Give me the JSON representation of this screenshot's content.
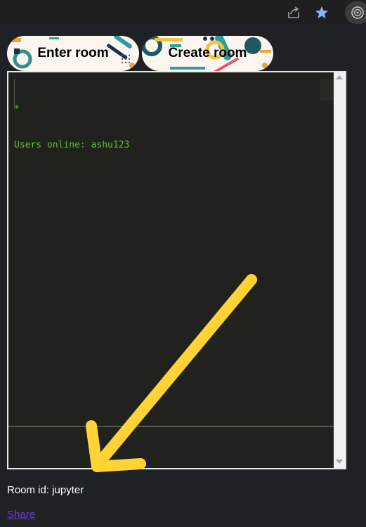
{
  "toolbar": {
    "share_icon": "share-icon",
    "star_icon": "star-icon",
    "profile_icon": "profile-icon",
    "star_color": "#8ab4f8"
  },
  "buttons": {
    "enter_room": "Enter room",
    "create_room": "Create room"
  },
  "terminal": {
    "lines": [
      "*",
      "Users online: ashu123"
    ],
    "text_color": "#5fbf3a",
    "background": "#21211d"
  },
  "room": {
    "label": "Room id: jupyter"
  },
  "share": {
    "label": "Share"
  },
  "annotation": {
    "arrow_color": "#ffd333"
  }
}
